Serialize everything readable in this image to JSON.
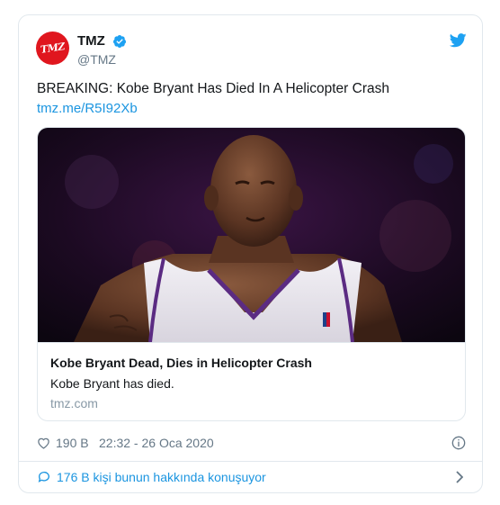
{
  "author": {
    "avatar_text": "TMZ",
    "name": "TMZ",
    "handle": "@TMZ",
    "verified": true
  },
  "tweet": {
    "text": "BREAKING: Kobe Bryant Has Died In A Helicopter Crash",
    "link": "tmz.me/R5I92Xb"
  },
  "card": {
    "image_alt": "Kobe Bryant",
    "title": "Kobe Bryant Dead, Dies in Helicopter Crash",
    "description": "Kobe Bryant has died.",
    "domain": "tmz.com"
  },
  "footer": {
    "likes": "190 B",
    "timestamp": "22:32 - 26 Oca 2020"
  },
  "conversation": {
    "text": "176 B kişi bunun hakkında konuşuyor"
  },
  "icons": {
    "brand": "twitter-logo-icon",
    "verified": "verified-badge-icon",
    "like": "heart-icon",
    "info": "info-icon",
    "comment": "comment-icon",
    "chevron": "chevron-right-icon"
  },
  "colors": {
    "brand_blue": "#1da1f2",
    "link_blue": "#1b95e0",
    "avatar_red": "#e0161e",
    "muted_text": "#657786",
    "border": "#e1e8ed"
  }
}
